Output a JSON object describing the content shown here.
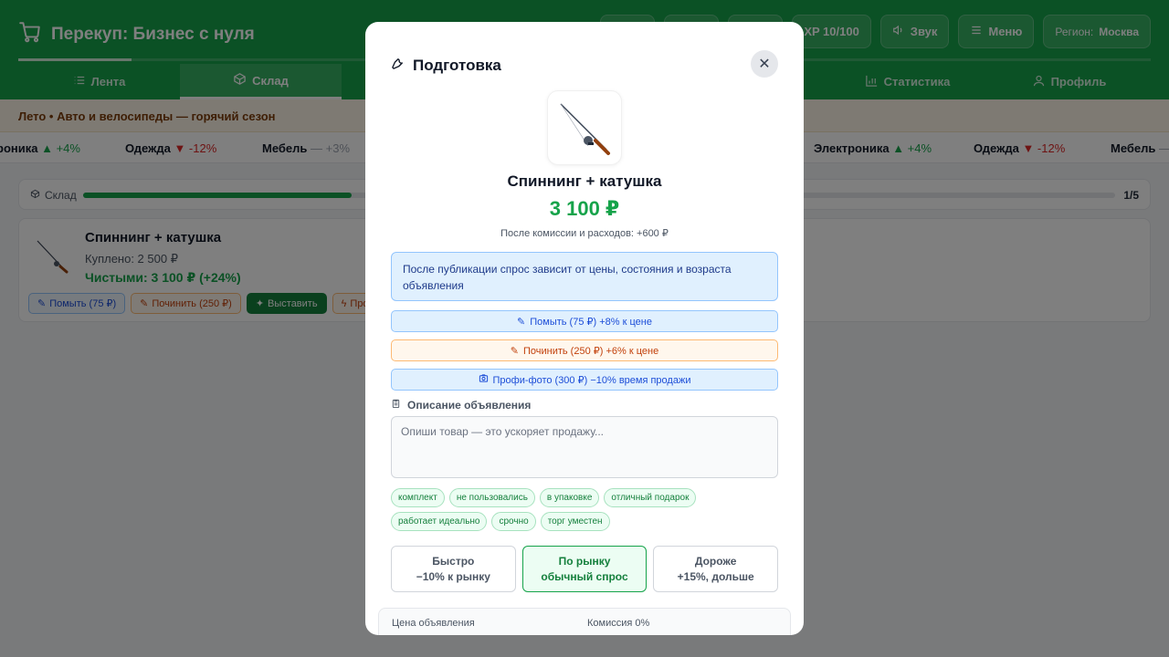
{
  "app": {
    "title": "Перекуп: Бизнес с нуля",
    "header_buttons": [
      {
        "label": ""
      },
      {
        "label": ""
      },
      {
        "label": ""
      },
      {
        "label": "XP 10/100"
      },
      {
        "label": "Звук"
      },
      {
        "label": "Меню"
      }
    ],
    "region_prefix": "Регион:",
    "region_value": "Москва"
  },
  "nav": {
    "tabs": [
      {
        "label": "Лента",
        "icon": "list-icon"
      },
      {
        "label": "Склад",
        "icon": "box-icon"
      },
      {
        "label": "",
        "icon": ""
      },
      {
        "label": "",
        "icon": ""
      },
      {
        "label": "",
        "icon": ""
      },
      {
        "label": "Статистика",
        "icon": "chart-icon"
      },
      {
        "label": "Профиль",
        "icon": "user-icon"
      }
    ]
  },
  "season": "Лето • Авто и велосипеды — горячий сезон",
  "ticker": [
    {
      "name": "роника",
      "change": "▲ +4%",
      "dir": "up"
    },
    {
      "name": "Одежда",
      "change": "▼ -12%",
      "dir": "down"
    },
    {
      "name": "Мебель",
      "change": "— +3%",
      "dir": "flat"
    },
    {
      "name": "Электроника",
      "change": "▲ +4%",
      "dir": "up"
    },
    {
      "name": "Одежда",
      "change": "▼ -12%",
      "dir": "down"
    },
    {
      "name": "Мебель",
      "change": "—",
      "dir": "flat"
    }
  ],
  "stock": {
    "label": "Склад",
    "count": "1/5",
    "fill_percent": 26
  },
  "item": {
    "title": "Спиннинг + катушка",
    "bought": "Куплено: 2 500 ₽",
    "net": "Чистыми: 3 100 ₽ (+24%)",
    "actions": [
      "Помыть (75 ₽)",
      "Починить (250 ₽)",
      "Выставить",
      "Про"
    ]
  },
  "modal": {
    "title": "Подготовка",
    "product_name": "Спиннинг + катушка",
    "price": "3 100 ₽",
    "after_fees": "После комиссии и расходов: +600 ₽",
    "info": "После публикации спрос зависит от цены, состояния и возраста объявления",
    "options": {
      "wash": "Помыть (75 ₽) +8% к цене",
      "fix": "Починить (250 ₽) +6% к цене",
      "photo": "Профи-фото (300 ₽) −10% время продажи"
    },
    "description_label": "Описание объявления",
    "description_placeholder": "Опиши товар — это ускоряет продажу...",
    "tags": [
      "комплект",
      "не пользовались",
      "в упаковке",
      "отличный подарок",
      "работает идеально",
      "срочно",
      "торг уместен"
    ],
    "strategies": [
      {
        "title": "Быстро",
        "subtitle": "−10% к рынку"
      },
      {
        "title": "По рынку",
        "subtitle": "обычный спрос"
      },
      {
        "title": "Дороже",
        "subtitle": "+15%, дольше"
      }
    ],
    "price_panel": {
      "listing_label": "Цена объявления",
      "commission_label": "Комиссия 0%"
    }
  },
  "colors": {
    "brand_green": "#16a34a",
    "info_blue": "#1d4ed8",
    "fix_orange": "#c2410c"
  }
}
